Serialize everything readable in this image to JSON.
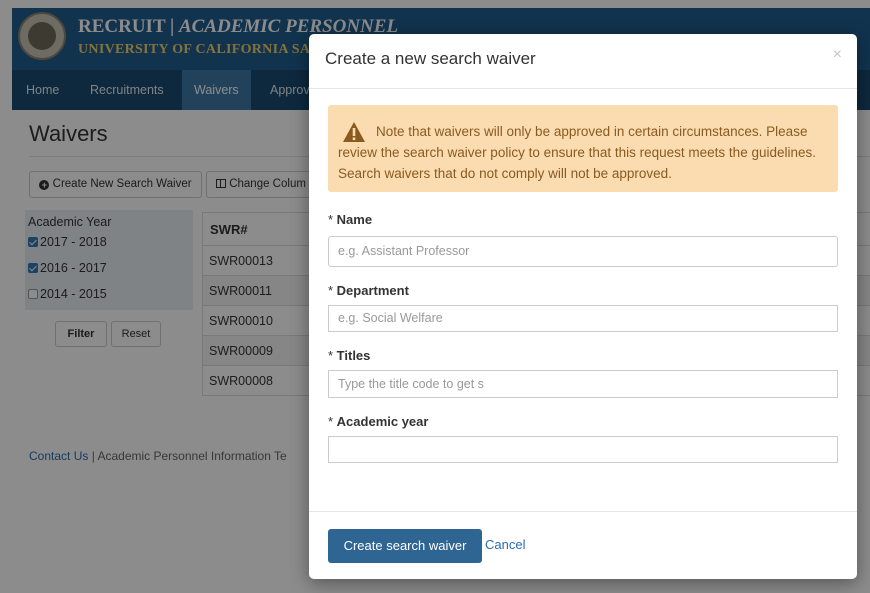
{
  "header": {
    "brand_part1": "RECRUIT",
    "brand_sep": " | ",
    "brand_part2": "ACADEMIC PERSONNEL",
    "brand_sub": "UNIVERSITY OF CALIFORNIA SANTA BAR"
  },
  "nav": {
    "items": [
      {
        "label": "Home"
      },
      {
        "label": "Recruitments"
      },
      {
        "label": "Waivers"
      },
      {
        "label": "Approv"
      }
    ],
    "active": "Waivers"
  },
  "page": {
    "title": "Waivers",
    "create_button": "Create New Search Waiver",
    "columns_button": "Change Colum"
  },
  "filter": {
    "heading": "Academic Year",
    "options": [
      {
        "label": "2017 - 2018",
        "checked": true
      },
      {
        "label": "2016 - 2017",
        "checked": true
      },
      {
        "label": "2014 - 2015",
        "checked": false
      }
    ],
    "filter_button": "Filter",
    "reset_button": "Reset"
  },
  "table": {
    "header": "SWR#",
    "rows": [
      "SWR00013",
      "SWR00011",
      "SWR00010",
      "SWR00009",
      "SWR00008"
    ]
  },
  "footer": {
    "link": "Contact Us",
    "text": " | Academic Personnel Information Te"
  },
  "modal": {
    "title": "Create a new search waiver",
    "close": "×",
    "alert": "Note that waivers will only be approved in certain circumstances. Please review the search waiver policy to ensure that this request meets the guidelines. Search waivers that do not comply will not be approved.",
    "fields": [
      {
        "label": "Name",
        "placeholder": "e.g. Assistant Professor"
      },
      {
        "label": "Department",
        "placeholder": "e.g. Social Welfare"
      },
      {
        "label": "Titles",
        "placeholder": "Type the title code to get s"
      },
      {
        "label": "Academic year",
        "placeholder": ""
      }
    ],
    "required_mark": "* ",
    "submit": "Create search waiver",
    "cancel": "Cancel"
  },
  "colors": {
    "header": "#1f5d8e",
    "nav": "#1a4a70",
    "nav_active": "#3f79a8",
    "primary": "#2e6593",
    "alert_bg": "#fbdcb1",
    "alert_text": "#8a5a1f"
  }
}
